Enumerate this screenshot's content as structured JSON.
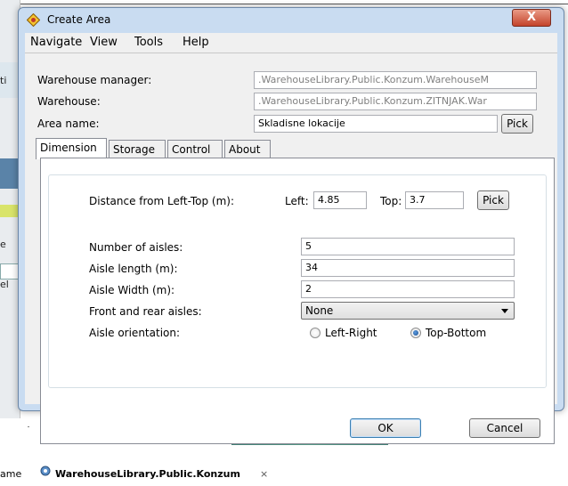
{
  "background": {
    "left_fragments": [
      "ti",
      "e",
      "el"
    ],
    "bottom_tab_prefix": "ame",
    "bottom_tab_label": "WarehouseLibrary.Public.Konzum",
    "bottom_tab_close": "×"
  },
  "dialog": {
    "title": "Create Area",
    "close_label": "X",
    "menu": [
      "Navigate",
      "View",
      "Tools",
      "Help"
    ],
    "fields": {
      "warehouse_manager_label": "Warehouse manager:",
      "warehouse_manager_value": ".WarehouseLibrary.Public.Konzum.WarehouseM",
      "warehouse_label": "Warehouse:",
      "warehouse_value": ".WarehouseLibrary.Public.Konzum.ZITNJAK.War",
      "area_name_label": "Area name:",
      "area_name_value": "Skladisne lokacije",
      "pick_label": "Pick"
    },
    "tabs": [
      "Dimension",
      "Storage",
      "Control",
      "About"
    ],
    "active_tab": "Dimension",
    "dimension": {
      "distance_label": "Distance from Left-Top  (m):",
      "left_label": "Left:",
      "left_value": "4.85",
      "top_label": "Top:",
      "top_value": "3.7",
      "pick_label": "Pick",
      "aisles_label": "Number of aisles:",
      "aisles_value": "5",
      "length_label": "Aisle length (m):",
      "length_value": "34",
      "width_label": "Aisle Width (m):",
      "width_value": "2",
      "front_rear_label": "Front and rear aisles:",
      "front_rear_value": "None",
      "orientation_label": "Aisle orientation:",
      "orientation_options": [
        "Left-Right",
        "Top-Bottom"
      ],
      "orientation_selected": "Top-Bottom"
    },
    "buttons": {
      "ok": "OK",
      "cancel": "Cancel"
    }
  }
}
